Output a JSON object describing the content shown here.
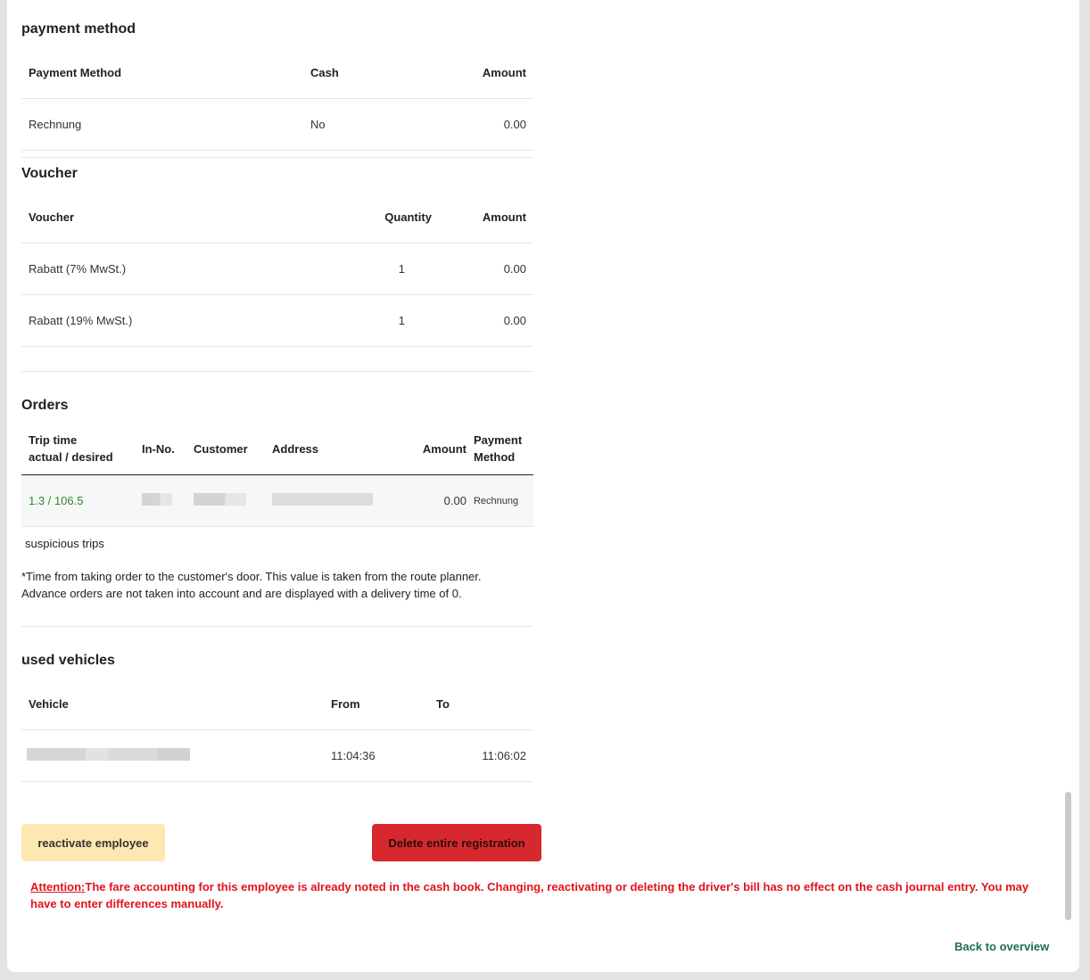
{
  "payment": {
    "title": "payment method",
    "headers": [
      "Payment Method",
      "Cash",
      "Amount"
    ],
    "rows": [
      [
        "Rechnung",
        "No",
        "0.00"
      ]
    ]
  },
  "voucher": {
    "title": "Voucher",
    "headers": [
      "Voucher",
      "Quantity",
      "Amount"
    ],
    "rows": [
      [
        "Rabatt (7% MwSt.)",
        "1",
        "0.00"
      ],
      [
        "Rabatt (19% MwSt.)",
        "1",
        "0.00"
      ]
    ]
  },
  "orders": {
    "title": "Orders",
    "headers": {
      "trip_time_line1": "Trip time",
      "trip_time_line2": "actual / desired",
      "in_no": "In-No.",
      "customer": "Customer",
      "address": "Address",
      "amount": "Amount",
      "payment_line1": "Payment",
      "payment_line2": "Method"
    },
    "row": {
      "trip_time": "1.3 / 106.5",
      "amount": "0.00",
      "payment_method": "Rechnung"
    },
    "suspicious": "suspicious trips",
    "note_line1": "*Time from taking order to the customer's door. This value is taken from the route planner.",
    "note_line2": "Advance orders are not taken into account and are displayed with a delivery time of 0."
  },
  "vehicles": {
    "title": "used vehicles",
    "headers": [
      "Vehicle",
      "From",
      "To"
    ],
    "row": {
      "from": "11:04:36",
      "to": "11:06:02"
    }
  },
  "actions": {
    "reactivate": "reactivate employee",
    "delete": "Delete entire registration"
  },
  "attention": {
    "label": "Attention:",
    "text": "The fare accounting for this employee is already noted in the cash book. Changing, reactivating or deleting the driver's bill has no effect on the cash journal entry. You may have to enter differences manually."
  },
  "back_link": "Back to overview",
  "colors": {
    "background": "#e4e2e2",
    "warning_button": "#fde8b2",
    "danger_button": "#d7292d",
    "attention_text": "#e3121b",
    "link": "#1f6b5c",
    "trip_time": "#2c8a2c"
  }
}
